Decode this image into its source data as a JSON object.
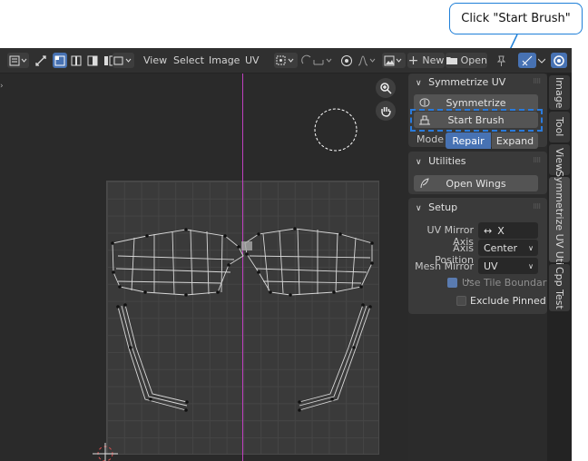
{
  "callout": {
    "text": "Click \"Start Brush\""
  },
  "header": {
    "menus": [
      "View",
      "Select",
      "Image",
      "UV"
    ],
    "new_label": "New",
    "open_label": "Open"
  },
  "sidebar": {
    "symmetrize_panel": {
      "title": "Symmetrize UV",
      "symmetrize_label": "Symmetrize",
      "start_brush_label": "Start Brush",
      "mode_label": "Mode",
      "mode_options": [
        "Repair",
        "Expand"
      ],
      "mode_selected": "Repair"
    },
    "utilities_panel": {
      "title": "Utilities",
      "open_wings_label": "Open Wings"
    },
    "setup_panel": {
      "title": "Setup",
      "uv_mirror_axis_label": "UV Mirror Axis",
      "uv_mirror_axis_value": "X",
      "axis_position_label": "Axis Position",
      "axis_position_value": "Center",
      "mesh_mirror_label": "Mesh Mirror ...",
      "mesh_mirror_value": "UV",
      "use_tile_boundary_label": "Use Tile Boundary",
      "use_tile_boundary_checked": true,
      "exclude_pinned_label": "Exclude Pinned",
      "exclude_pinned_checked": false
    }
  },
  "tabs": [
    "Image",
    "Tool",
    "View",
    "Symmetrize UV Util",
    "Cpp Test"
  ],
  "colors": {
    "accent": "#4772b3",
    "highlight": "#2a7bdc",
    "axis": "#c040c0"
  }
}
